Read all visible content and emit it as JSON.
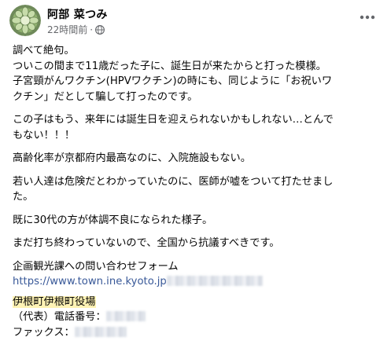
{
  "post": {
    "author": "阿部 菜つみ",
    "timestamp": "22時間前",
    "dot": "·",
    "lines": {
      "l1": "調べて絶句。",
      "l2": "ついこの間まで11歳だった子に、誕生日が来たからと打った模様。",
      "l3": "子宮頸がんワクチン(HPVワクチン)の時にも、同じように「お祝いワ",
      "l4": "クチン」だとして騙して打ったのです。",
      "l5": "この子はもう、来年には誕生日を迎えられないかもしれない…とんで",
      "l6": "もない！！！",
      "l7": "高齢化率が京都府内最高なのに、入院施設もない。",
      "l8": "若い人達は危険だとわかっていたのに、医師が嘘をついて打たせまし",
      "l9": "た。",
      "l10": "既に30代の方が体調不良になられた様子。",
      "l11": "まだ打ち終わっていないので、全国から抗議すべきです。",
      "l12": "企画観光課への問い合わせフォーム",
      "link": "https://www.town.ine.kyoto.jp",
      "office": "伊根町伊根町役場",
      "phone_label": "（代表）電話番号：",
      "fax_label": "ファックス："
    }
  }
}
